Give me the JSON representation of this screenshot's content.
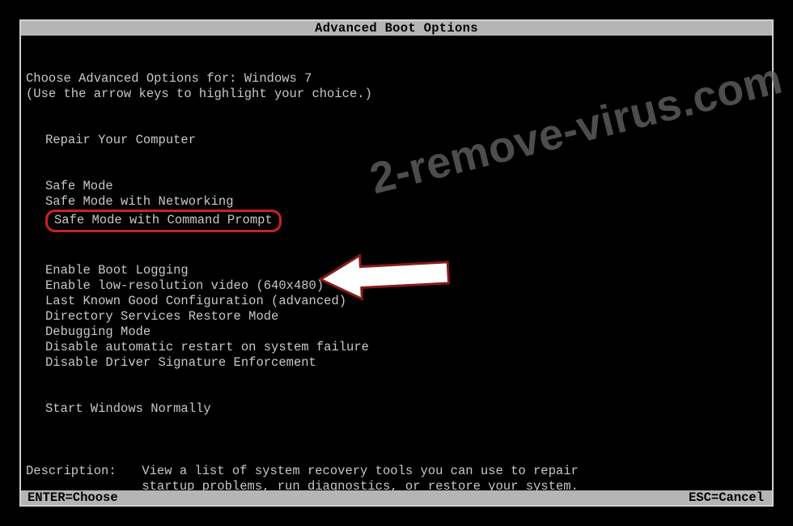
{
  "title": "Advanced Boot Options",
  "watermark": "2-remove-virus.com",
  "intro_line1_prefix": "Choose Advanced Options for: ",
  "intro_line1_os": "Windows 7",
  "intro_line2": "(Use the arrow keys to highlight your choice.)",
  "repair": "Repair Your Computer",
  "options_a": {
    "0": "Safe Mode",
    "1": "Safe Mode with Networking",
    "2": "Safe Mode with Command Prompt"
  },
  "options_b": {
    "0": "Enable Boot Logging",
    "1": "Enable low-resolution video (640x480)",
    "2": "Last Known Good Configuration (advanced)",
    "3": "Directory Services Restore Mode",
    "4": "Debugging Mode",
    "5": "Disable automatic restart on system failure",
    "6": "Disable Driver Signature Enforcement"
  },
  "start_normal": "Start Windows Normally",
  "desc_label": "Description:",
  "desc_text_l1": "View a list of system recovery tools you can use to repair",
  "desc_text_l2": "startup problems, run diagnostics, or restore your system.",
  "footer_left": "ENTER=Choose",
  "footer_right": "ESC=Cancel"
}
